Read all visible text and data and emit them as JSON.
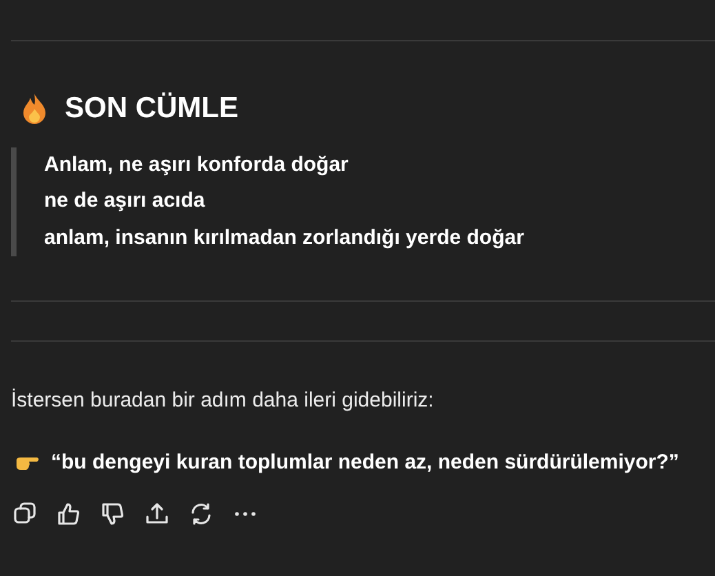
{
  "heading": {
    "text": "SON CÜMLE"
  },
  "quote": {
    "lines": [
      "Anlam, ne aşırı konforda doğar",
      "ne de aşırı acıda",
      "anlam, insanın kırılmadan zorlandığı yerde doğar"
    ]
  },
  "paragraph": "İstersen buradan bir adım daha ileri gidebiliriz:",
  "suggestion": "“bu dengeyi kuran toplumlar neden az, neden sürdürülemiyor?”",
  "actions": [
    {
      "kind": "copy"
    },
    {
      "kind": "like"
    },
    {
      "kind": "dislike"
    },
    {
      "kind": "share"
    },
    {
      "kind": "retry"
    },
    {
      "kind": "more"
    }
  ]
}
